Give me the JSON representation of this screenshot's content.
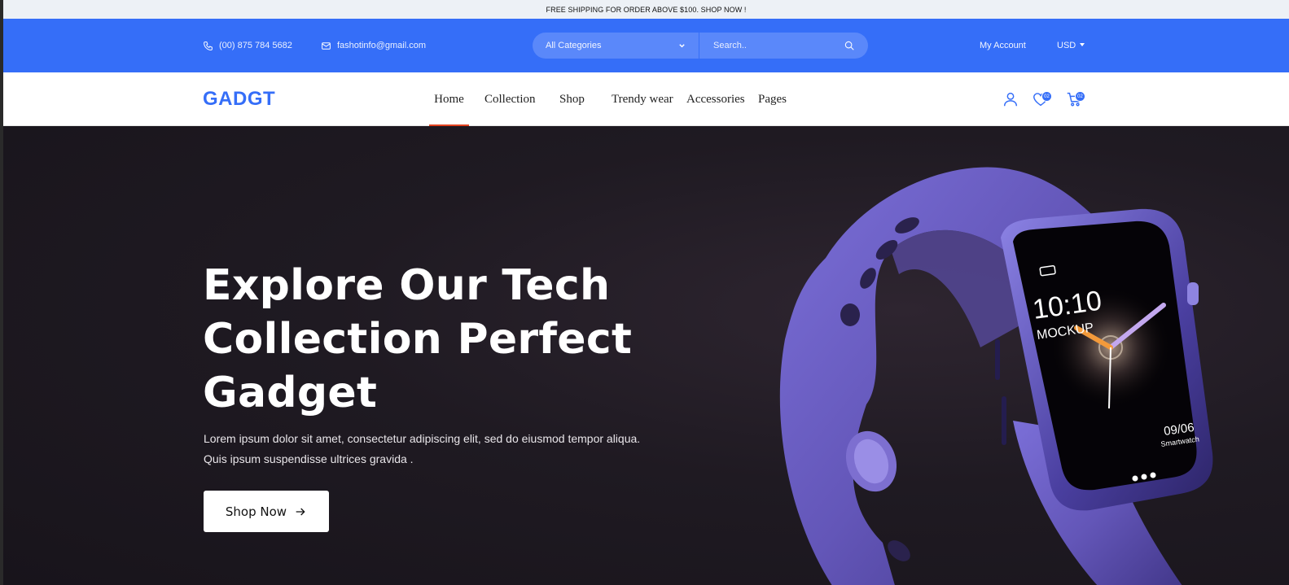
{
  "announcement": "FREE SHIPPING FOR ORDER ABOVE $100. SHOP NOW !",
  "topbar": {
    "phone": "(00) 875 784 5682",
    "email": "fashotinfo@gmail.com",
    "category_select": "All Categories",
    "search_placeholder": "Search..",
    "account": "My Account",
    "currency": "USD"
  },
  "navbar": {
    "logo": "GADGT",
    "menu": [
      "Home",
      "Collection",
      "Shop",
      "Trendy wear",
      "Accessories",
      "Pages"
    ],
    "active_item": "Home",
    "wishlist_count": "02",
    "cart_count": "02"
  },
  "hero": {
    "title": "Explore Our Tech Collection Perfect Gadget",
    "description": "Lorem ipsum dolor sit amet, consectetur adipiscing elit, sed do eiusmod tempor aliqua. Quis ipsum suspendisse ultrices gravida .",
    "button": "Shop Now",
    "watch_time": "10:10",
    "watch_label": "MOCKUP",
    "watch_date": "09/06",
    "watch_brand": "Smartwatch"
  },
  "colors": {
    "brand": "#356ef8",
    "active_underline": "#e2421f",
    "hero_bg": "#1f1a22"
  }
}
